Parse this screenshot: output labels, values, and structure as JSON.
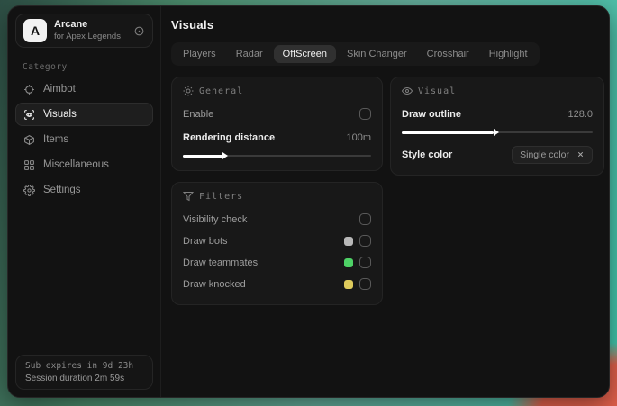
{
  "sidebar": {
    "logo_letter": "A",
    "title": "Arcane",
    "subtitle": "for Apex Legends",
    "category_label": "Category",
    "items": [
      {
        "label": "Aimbot"
      },
      {
        "label": "Visuals"
      },
      {
        "label": "Items"
      },
      {
        "label": "Miscellaneous"
      },
      {
        "label": "Settings"
      }
    ],
    "active_item": "Visuals",
    "footer": {
      "sub_expires": "Sub expires in 9d 23h",
      "session_duration": "Session duration 2m 59s"
    }
  },
  "main": {
    "title": "Visuals",
    "tabs": [
      {
        "label": "Players"
      },
      {
        "label": "Radar"
      },
      {
        "label": "OffScreen"
      },
      {
        "label": "Skin Changer"
      },
      {
        "label": "Crosshair"
      },
      {
        "label": "Highlight"
      }
    ],
    "active_tab": "OffScreen",
    "general": {
      "title": "General",
      "enable_label": "Enable",
      "rendering_distance_label": "Rendering distance",
      "rendering_distance_value": "100m",
      "rendering_distance_fill": "21%"
    },
    "visual": {
      "title": "Visual",
      "draw_outline_label": "Draw outline",
      "draw_outline_value": "128.0",
      "draw_outline_fill": "48%",
      "style_color_label": "Style color",
      "style_color_value": "Single color"
    },
    "filters": {
      "title": "Filters",
      "rows": [
        {
          "label": "Visibility check",
          "swatch": null
        },
        {
          "label": "Draw bots",
          "swatch": "#b8b8b8"
        },
        {
          "label": "Draw teammates",
          "swatch": "#4ed166"
        },
        {
          "label": "Draw knocked",
          "swatch": "#decb5c"
        }
      ]
    }
  },
  "colors": {
    "desktop_teal": "#3fc9ae",
    "desktop_green": "#4c8d6d",
    "desktop_salmon": "#e2604b",
    "panel_bg": "#181818",
    "window_bg": "#121212"
  }
}
